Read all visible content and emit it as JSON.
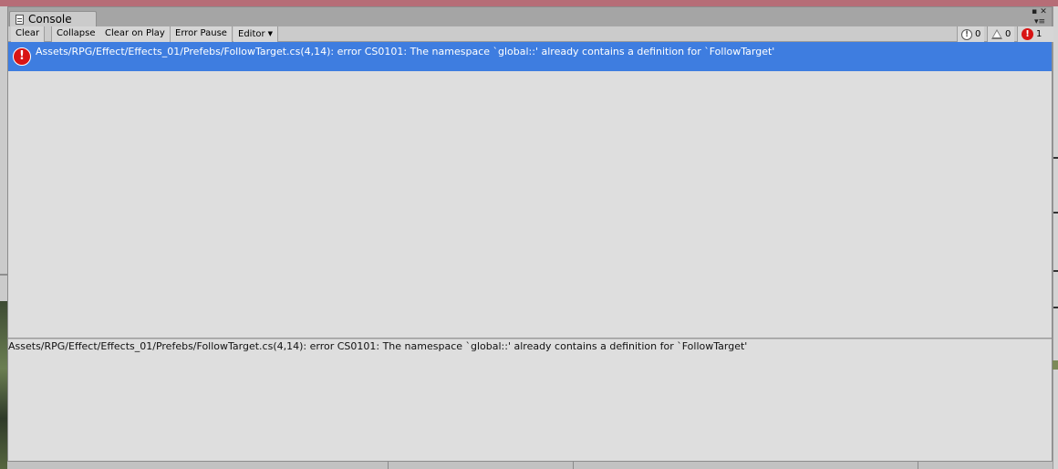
{
  "window": {
    "tab_title": "Console",
    "tab_icon": "console-icon",
    "menu_glyph": "▪ ✕",
    "options_glyph": "▾≡"
  },
  "toolbar": {
    "clear": "Clear",
    "collapse": "Collapse",
    "clear_on_play": "Clear on Play",
    "error_pause": "Error Pause",
    "editor": "Editor",
    "editor_caret": "▼"
  },
  "counters": {
    "info": {
      "icon": "info-icon",
      "count": "0"
    },
    "warning": {
      "icon": "warning-icon",
      "count": "0"
    },
    "error": {
      "icon": "error-icon",
      "count": "1"
    }
  },
  "log": {
    "entries": [
      {
        "type": "error",
        "icon": "error-icon",
        "message": "Assets/RPG/Effect/Effects_01/Prefebs/FollowTarget.cs(4,14): error CS0101: The namespace `global::' already contains a definition for `FollowTarget'",
        "selected": true
      }
    ],
    "detail": "Assets/RPG/Effect/Effects_01/Prefebs/FollowTarget.cs(4,14): error CS0101: The namespace `global::' already contains a definition for `FollowTarget'"
  },
  "colors": {
    "selection": "#3e7de0",
    "error": "#d81414",
    "panel": "#dedede",
    "title_bar": "#b66d77"
  }
}
